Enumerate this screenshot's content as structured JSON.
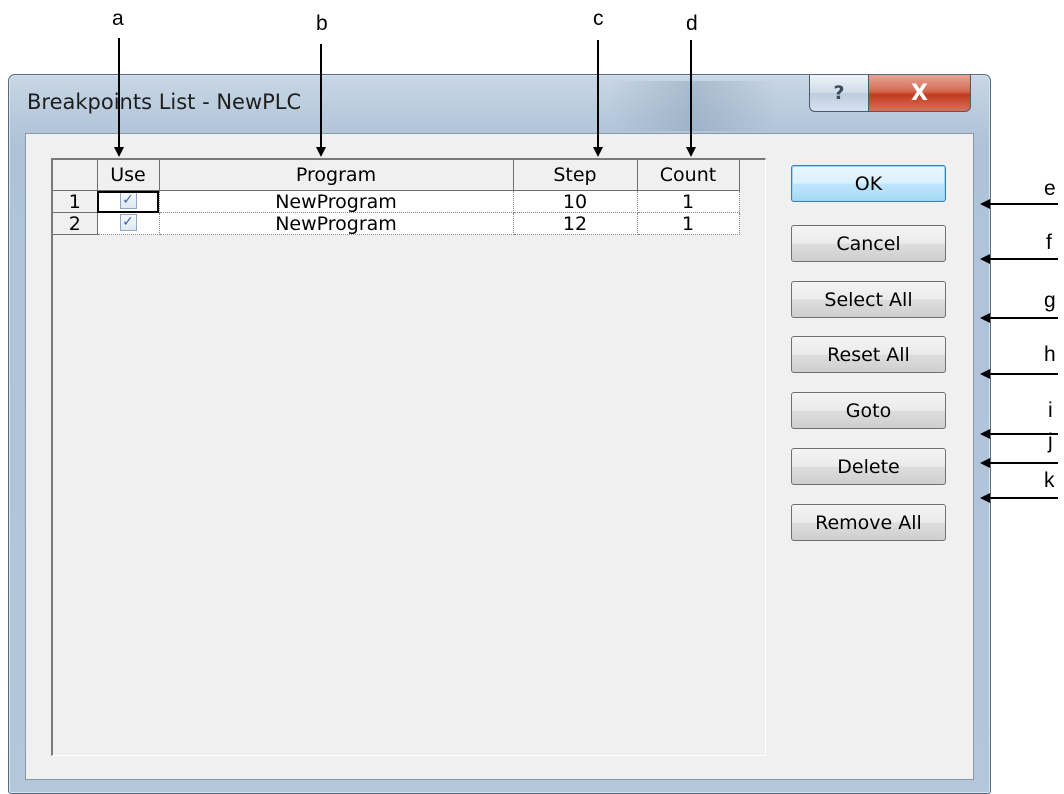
{
  "callouts": {
    "a": "a",
    "b": "b",
    "c": "c",
    "d": "d",
    "e": "e",
    "f": "f",
    "g": "g",
    "h": "h",
    "i": "i",
    "j": "j",
    "k": "k"
  },
  "window": {
    "title": "Breakpoints List - NewPLC",
    "help_glyph": "?",
    "close_glyph": "X"
  },
  "grid": {
    "columns": [
      "Use",
      "Program",
      "Step",
      "Count"
    ],
    "rows": [
      {
        "index": "1",
        "use": true,
        "program": "NewProgram",
        "step": "10",
        "count": "1"
      },
      {
        "index": "2",
        "use": true,
        "program": "NewProgram",
        "step": "12",
        "count": "1"
      }
    ],
    "check_glyph": "✓"
  },
  "buttons": {
    "ok": "OK",
    "cancel": "Cancel",
    "select_all": "Select All",
    "reset_all": "Reset All",
    "goto": "Goto",
    "delete": "Delete",
    "remove_all": "Remove All"
  },
  "colors": {
    "window_frame": "#b8cadc",
    "client_bg": "#f0f0f0",
    "close_button": "#c23a1f",
    "default_button": "#bee6fd",
    "checkbox_check": "#3a66b0"
  }
}
